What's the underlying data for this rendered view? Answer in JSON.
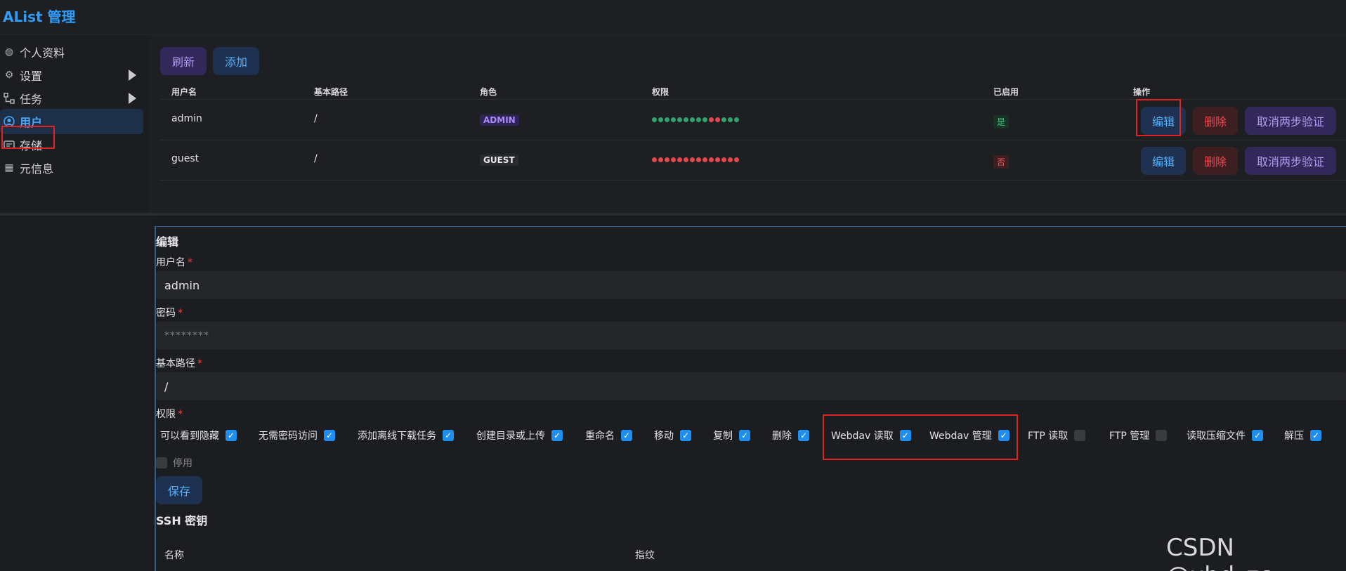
{
  "app": {
    "title": "AList 管理"
  },
  "sidebar": {
    "items": [
      {
        "label": "个人资料",
        "icon": "fingerprint-icon"
      },
      {
        "label": "设置",
        "icon": "gear-icon"
      },
      {
        "label": "任务",
        "icon": "tasks-icon"
      },
      {
        "label": "用户",
        "icon": "user-circle-icon"
      },
      {
        "label": "存储",
        "icon": "storage-icon"
      },
      {
        "label": "元信息",
        "icon": "meta-icon"
      }
    ]
  },
  "toolbar": {
    "refresh": "刷新",
    "add": "添加"
  },
  "users_table": {
    "columns": [
      "用户名",
      "基本路径",
      "角色",
      "权限",
      "已启用",
      "操作"
    ],
    "rows": [
      {
        "username": "admin",
        "base_path": "/",
        "role": "ADMIN",
        "permissions": [
          1,
          1,
          1,
          1,
          1,
          1,
          1,
          1,
          1,
          0,
          0,
          1,
          1,
          1
        ],
        "enabled": "是",
        "enabled_color": "#30a46c"
      },
      {
        "username": "guest",
        "base_path": "/",
        "role": "GUEST",
        "permissions": [
          0,
          0,
          0,
          0,
          0,
          0,
          0,
          0,
          0,
          0,
          0,
          0,
          0,
          0
        ],
        "enabled": "否",
        "enabled_color": "#e5484d"
      }
    ],
    "actions": {
      "edit": "编辑",
      "delete": "删除",
      "cancel_2fa": "取消两步验证"
    }
  },
  "edit_form": {
    "title": "编辑",
    "username_label": "用户名",
    "username_value": "admin",
    "password_label": "密码",
    "password_placeholder": "********",
    "base_path_label": "基本路径",
    "base_path_value": "/",
    "permissions_label": "权限",
    "required_mark": "*",
    "permissions": [
      {
        "label": "可以看到隐藏",
        "checked": true
      },
      {
        "label": "无需密码访问",
        "checked": true
      },
      {
        "label": "添加离线下载任务",
        "checked": true
      },
      {
        "label": "创建目录或上传",
        "checked": true
      },
      {
        "label": "重命名",
        "checked": true
      },
      {
        "label": "移动",
        "checked": true
      },
      {
        "label": "复制",
        "checked": true
      },
      {
        "label": "删除",
        "checked": true
      },
      {
        "label": "Webdav 读取",
        "checked": true
      },
      {
        "label": "Webdav 管理",
        "checked": true
      },
      {
        "label": "FTP 读取",
        "checked": false
      },
      {
        "label": "FTP 管理",
        "checked": false
      },
      {
        "label": "读取压缩文件",
        "checked": true
      },
      {
        "label": "解压",
        "checked": true
      }
    ],
    "disabled_label": "停用",
    "disabled_checked": false,
    "save": "保存",
    "ssh_title": "SSH 密钥",
    "ssh_columns": [
      "名称",
      "指纹"
    ]
  },
  "watermark": "CSDN @xbd_zc",
  "colors": {
    "accent": "#2e9cf8",
    "highlight": "#e02424",
    "perm_on": "#30a46c",
    "perm_off": "#e5484d"
  }
}
